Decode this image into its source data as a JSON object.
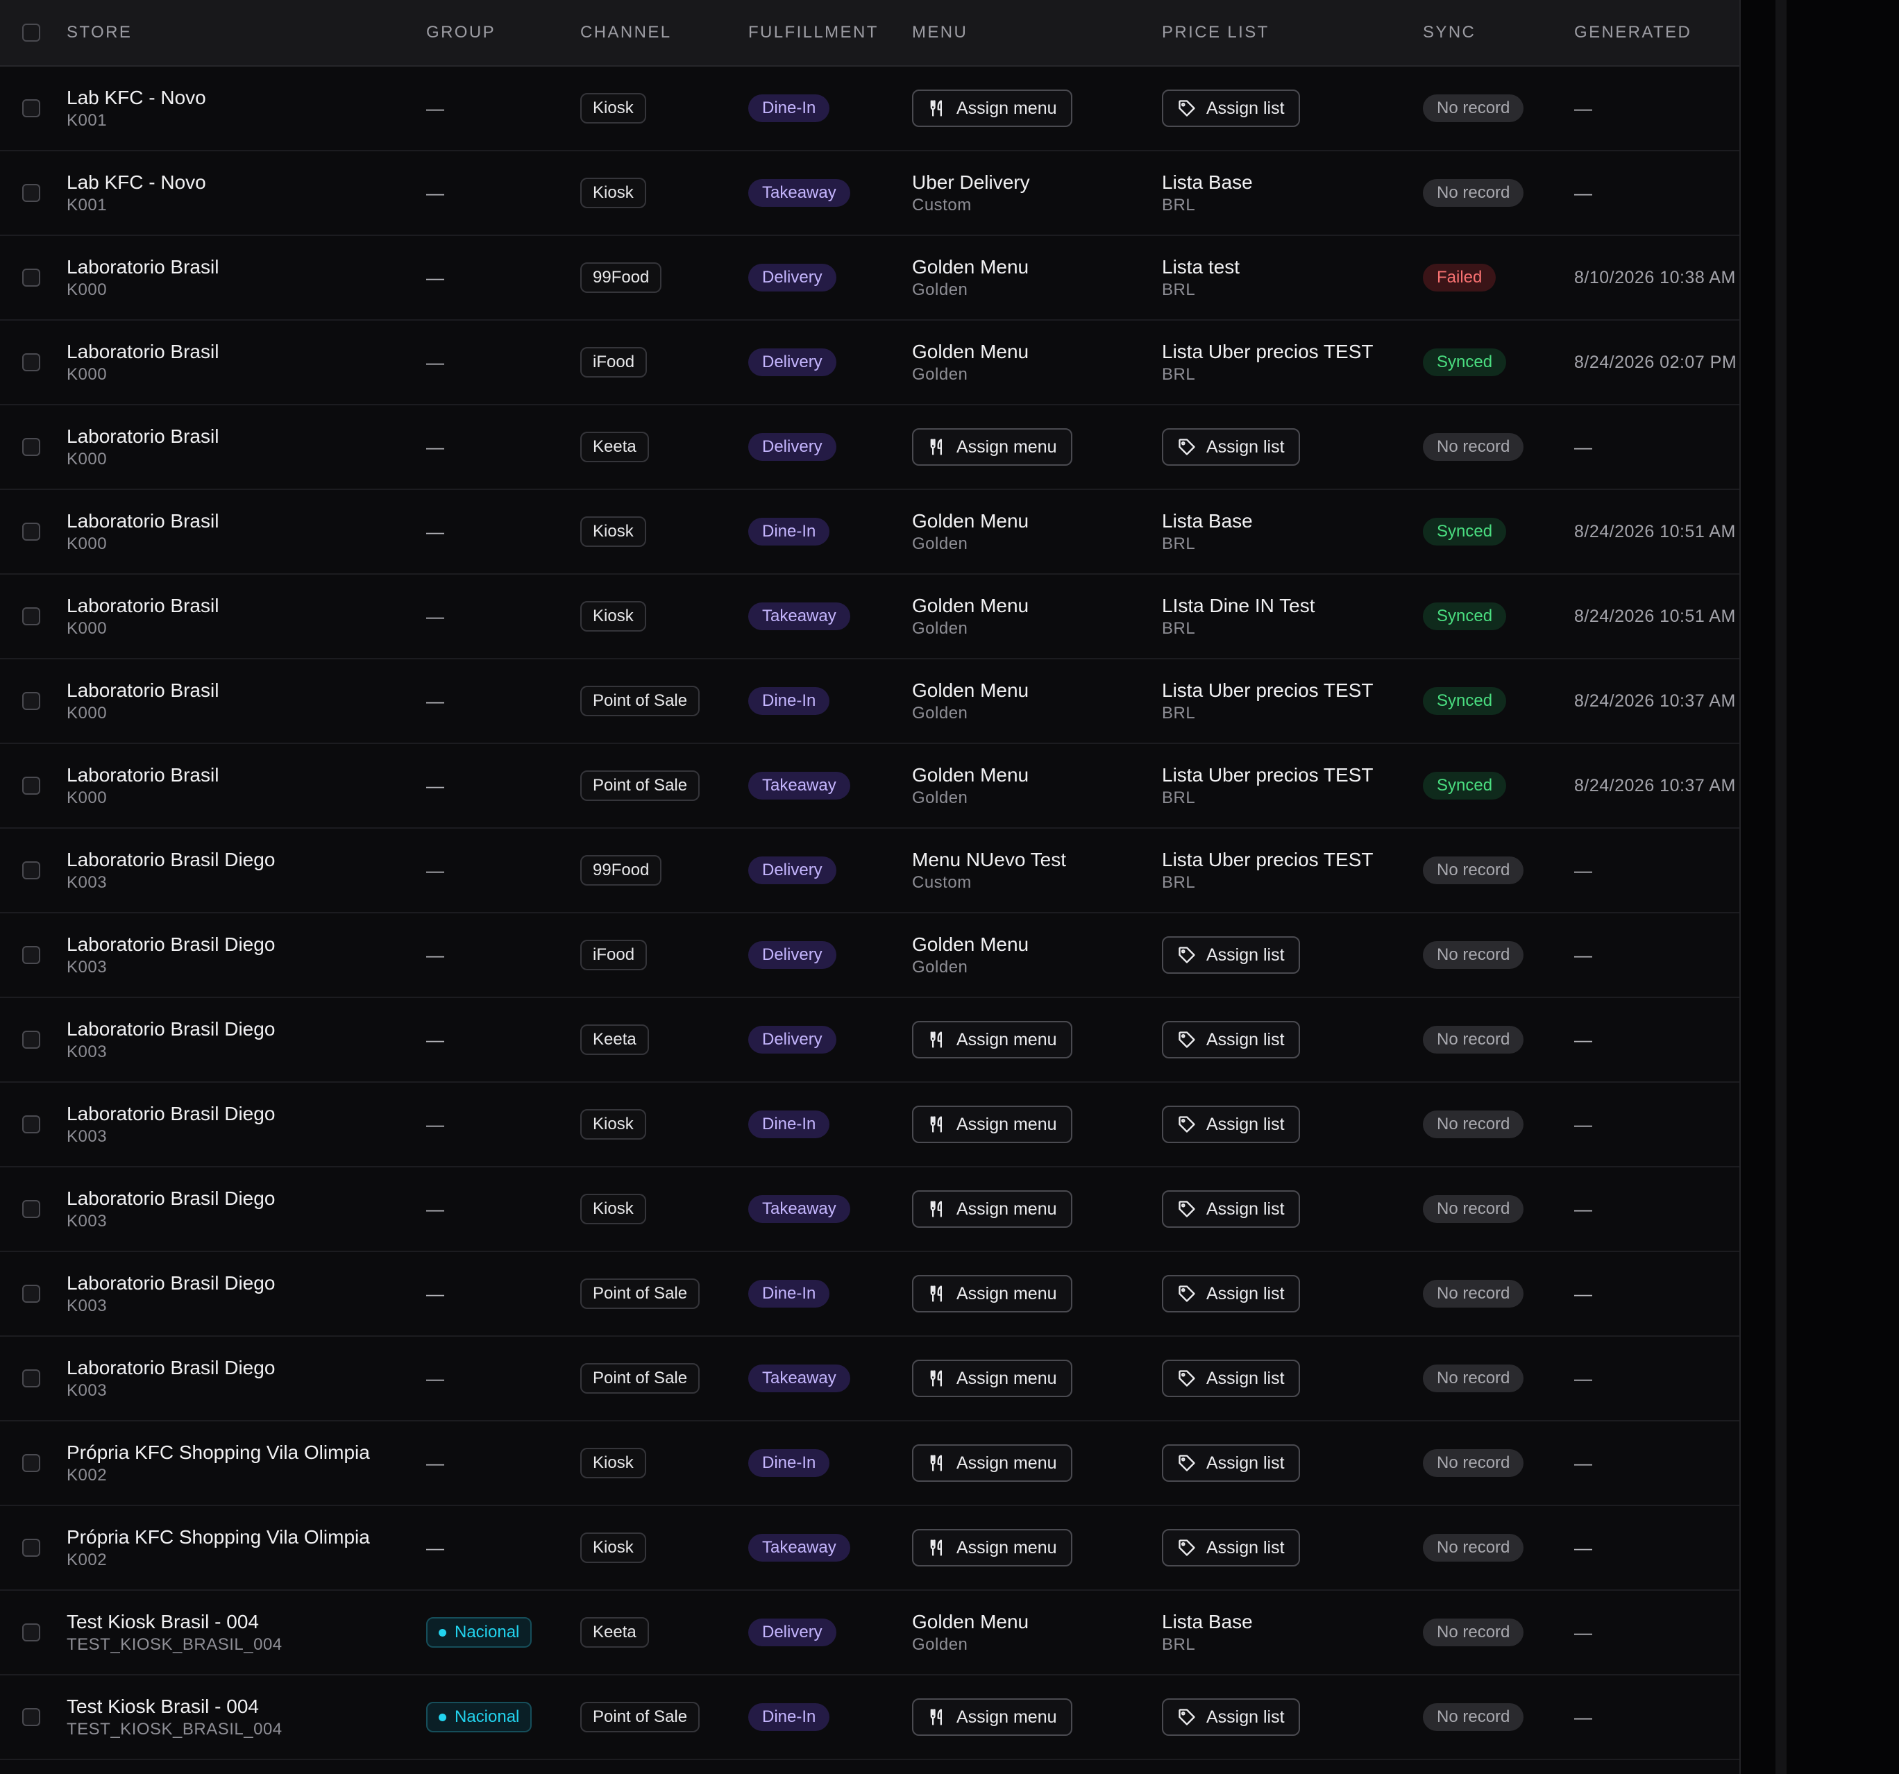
{
  "columns": {
    "store": "STORE",
    "group": "GROUP",
    "channel": "CHANNEL",
    "fulfillment": "FULFILLMENT",
    "menu": "MENU",
    "price_list": "PRICE LIST",
    "sync": "SYNC",
    "generated": "GENERATED"
  },
  "rows": [
    {
      "store": "Lab KFC - Novo",
      "code": "K001",
      "group": "—",
      "channel": "Kiosk",
      "fulfillment": "Dine-In",
      "menu": null,
      "menu_sub": null,
      "price": null,
      "price_sub": null,
      "sync": "No record",
      "sync_status": "none",
      "generated": "—"
    },
    {
      "store": "Lab KFC - Novo",
      "code": "K001",
      "group": "—",
      "channel": "Kiosk",
      "fulfillment": "Takeaway",
      "menu": "Uber Delivery",
      "menu_sub": "Custom",
      "price": "Lista Base",
      "price_sub": "BRL",
      "sync": "No record",
      "sync_status": "none",
      "generated": "—"
    },
    {
      "store": "Laboratorio Brasil",
      "code": "K000",
      "group": "—",
      "channel": "99Food",
      "fulfillment": "Delivery",
      "menu": "Golden Menu",
      "menu_sub": "Golden",
      "price": "Lista test",
      "price_sub": "BRL",
      "sync": "Failed",
      "sync_status": "failed",
      "generated": "8/10/2026 10:38 AM"
    },
    {
      "store": "Laboratorio Brasil",
      "code": "K000",
      "group": "—",
      "channel": "iFood",
      "fulfillment": "Delivery",
      "menu": "Golden Menu",
      "menu_sub": "Golden",
      "price": "Lista Uber precios TEST",
      "price_sub": "BRL",
      "sync": "Synced",
      "sync_status": "synced",
      "generated": "8/24/2026 02:07 PM"
    },
    {
      "store": "Laboratorio Brasil",
      "code": "K000",
      "group": "—",
      "channel": "Keeta",
      "fulfillment": "Delivery",
      "menu": null,
      "menu_sub": null,
      "price": null,
      "price_sub": null,
      "sync": "No record",
      "sync_status": "none",
      "generated": "—"
    },
    {
      "store": "Laboratorio Brasil",
      "code": "K000",
      "group": "—",
      "channel": "Kiosk",
      "fulfillment": "Dine-In",
      "menu": "Golden Menu",
      "menu_sub": "Golden",
      "price": "Lista Base",
      "price_sub": "BRL",
      "sync": "Synced",
      "sync_status": "synced",
      "generated": "8/24/2026 10:51 AM"
    },
    {
      "store": "Laboratorio Brasil",
      "code": "K000",
      "group": "—",
      "channel": "Kiosk",
      "fulfillment": "Takeaway",
      "menu": "Golden Menu",
      "menu_sub": "Golden",
      "price": "LIsta Dine IN Test",
      "price_sub": "BRL",
      "sync": "Synced",
      "sync_status": "synced",
      "generated": "8/24/2026 10:51 AM"
    },
    {
      "store": "Laboratorio Brasil",
      "code": "K000",
      "group": "—",
      "channel": "Point of Sale",
      "fulfillment": "Dine-In",
      "menu": "Golden Menu",
      "menu_sub": "Golden",
      "price": "Lista Uber precios TEST",
      "price_sub": "BRL",
      "sync": "Synced",
      "sync_status": "synced",
      "generated": "8/24/2026 10:37 AM"
    },
    {
      "store": "Laboratorio Brasil",
      "code": "K000",
      "group": "—",
      "channel": "Point of Sale",
      "fulfillment": "Takeaway",
      "menu": "Golden Menu",
      "menu_sub": "Golden",
      "price": "Lista Uber precios TEST",
      "price_sub": "BRL",
      "sync": "Synced",
      "sync_status": "synced",
      "generated": "8/24/2026 10:37 AM"
    },
    {
      "store": "Laboratorio Brasil Diego",
      "code": "K003",
      "group": "—",
      "channel": "99Food",
      "fulfillment": "Delivery",
      "menu": "Menu NUevo Test",
      "menu_sub": "Custom",
      "price": "Lista Uber precios TEST",
      "price_sub": "BRL",
      "sync": "No record",
      "sync_status": "none",
      "generated": "—"
    },
    {
      "store": "Laboratorio Brasil Diego",
      "code": "K003",
      "group": "—",
      "channel": "iFood",
      "fulfillment": "Delivery",
      "menu": "Golden Menu",
      "menu_sub": "Golden",
      "price": null,
      "price_sub": null,
      "sync": "No record",
      "sync_status": "none",
      "generated": "—"
    },
    {
      "store": "Laboratorio Brasil Diego",
      "code": "K003",
      "group": "—",
      "channel": "Keeta",
      "fulfillment": "Delivery",
      "menu": null,
      "menu_sub": null,
      "price": null,
      "price_sub": null,
      "sync": "No record",
      "sync_status": "none",
      "generated": "—"
    },
    {
      "store": "Laboratorio Brasil Diego",
      "code": "K003",
      "group": "—",
      "channel": "Kiosk",
      "fulfillment": "Dine-In",
      "menu": null,
      "menu_sub": null,
      "price": null,
      "price_sub": null,
      "sync": "No record",
      "sync_status": "none",
      "generated": "—"
    },
    {
      "store": "Laboratorio Brasil Diego",
      "code": "K003",
      "group": "—",
      "channel": "Kiosk",
      "fulfillment": "Takeaway",
      "menu": null,
      "menu_sub": null,
      "price": null,
      "price_sub": null,
      "sync": "No record",
      "sync_status": "none",
      "generated": "—"
    },
    {
      "store": "Laboratorio Brasil Diego",
      "code": "K003",
      "group": "—",
      "channel": "Point of Sale",
      "fulfillment": "Dine-In",
      "menu": null,
      "menu_sub": null,
      "price": null,
      "price_sub": null,
      "sync": "No record",
      "sync_status": "none",
      "generated": "—"
    },
    {
      "store": "Laboratorio Brasil Diego",
      "code": "K003",
      "group": "—",
      "channel": "Point of Sale",
      "fulfillment": "Takeaway",
      "menu": null,
      "menu_sub": null,
      "price": null,
      "price_sub": null,
      "sync": "No record",
      "sync_status": "none",
      "generated": "—"
    },
    {
      "store": "Própria KFC Shopping Vila Olimpia",
      "code": "K002",
      "group": "—",
      "channel": "Kiosk",
      "fulfillment": "Dine-In",
      "menu": null,
      "menu_sub": null,
      "price": null,
      "price_sub": null,
      "sync": "No record",
      "sync_status": "none",
      "generated": "—"
    },
    {
      "store": "Própria KFC Shopping Vila Olimpia",
      "code": "K002",
      "group": "—",
      "channel": "Kiosk",
      "fulfillment": "Takeaway",
      "menu": null,
      "menu_sub": null,
      "price": null,
      "price_sub": null,
      "sync": "No record",
      "sync_status": "none",
      "generated": "—"
    },
    {
      "store": "Test Kiosk Brasil - 004",
      "code": "TEST_KIOSK_BRASIL_004",
      "group": "Nacional",
      "channel": "Keeta",
      "fulfillment": "Delivery",
      "menu": "Golden Menu",
      "menu_sub": "Golden",
      "price": "Lista Base",
      "price_sub": "BRL",
      "sync": "No record",
      "sync_status": "none",
      "generated": "—"
    },
    {
      "store": "Test Kiosk Brasil - 004",
      "code": "TEST_KIOSK_BRASIL_004",
      "group": "Nacional",
      "channel": "Point of Sale",
      "fulfillment": "Dine-In",
      "menu": null,
      "menu_sub": null,
      "price": null,
      "price_sub": null,
      "sync": "No record",
      "sync_status": "none",
      "generated": "—"
    }
  ],
  "actions": {
    "assign_menu": "Assign menu",
    "assign_list": "Assign list"
  },
  "icons": {
    "menu": "utensils-icon",
    "list": "tag-icon",
    "group": "dot-icon"
  },
  "colors": {
    "fulfillment_badge": "#c4b5fd",
    "synced": "#4ade80",
    "failed": "#f87171",
    "group_badge": "#22d3ee"
  }
}
